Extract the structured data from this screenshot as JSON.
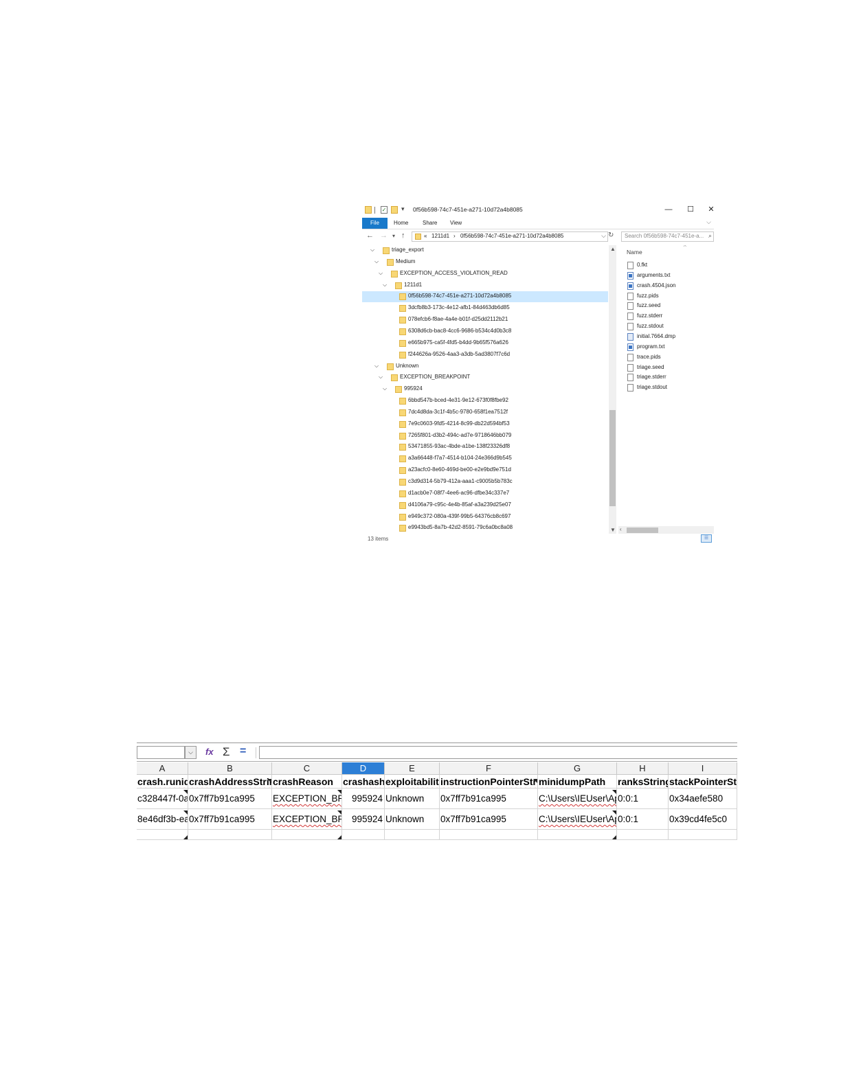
{
  "explorer": {
    "title": "0f56b598-74c7-451e-a271-10d72a4b8085",
    "window_controls": {
      "minimize": "—",
      "maximize": "☐",
      "close": "✕"
    },
    "ribbon_tabs": [
      "File",
      "Home",
      "Share",
      "View"
    ],
    "address": {
      "prefix": "«",
      "crumbs": [
        "1211d1",
        "0f56b598-74c7-451e-a271-10d72a4b8085"
      ],
      "separator": "›"
    },
    "search_placeholder": "Search 0f56b598-74c7-451e-a...",
    "tree": [
      {
        "label": "triage_export",
        "level": 0,
        "expanded": true
      },
      {
        "label": "Medium",
        "level": 1,
        "expanded": true
      },
      {
        "label": "EXCEPTION_ACCESS_VIOLATION_READ",
        "level": 2,
        "expanded": true
      },
      {
        "label": "1211d1",
        "level": 3,
        "expanded": true
      },
      {
        "label": "0f56b598-74c7-451e-a271-10d72a4b8085",
        "level": 4,
        "selected": true
      },
      {
        "label": "3dcfb8b3-173c-4e12-afb1-84d463db6d85",
        "level": 4
      },
      {
        "label": "078efcb6-f8ae-4a4e-b01f-d25dd2112b21",
        "level": 4
      },
      {
        "label": "6308d6cb-bac8-4cc6-9686-b534c4d0b3c8",
        "level": 4
      },
      {
        "label": "e665b975-ca5f-4fd5-b4dd-9b65f576a626",
        "level": 4
      },
      {
        "label": "f244626a-9526-4aa3-a3db-5ad3807f7c6d",
        "level": 4
      },
      {
        "label": "Unknown",
        "level": 1,
        "expanded": true
      },
      {
        "label": "EXCEPTION_BREAKPOINT",
        "level": 2,
        "expanded": true
      },
      {
        "label": "995924",
        "level": 3,
        "expanded": true
      },
      {
        "label": "6bbd547b-bced-4e31-9e12-673f0f8fbe92",
        "level": 4
      },
      {
        "label": "7dc4d8da-3c1f-4b5c-9780-658f1ea7512f",
        "level": 4
      },
      {
        "label": "7e9c0603-9fd5-4214-8c99-db22d594bf53",
        "level": 4
      },
      {
        "label": "7265f801-d3b2-494c-ad7e-9718646bb079",
        "level": 4
      },
      {
        "label": "53471855-93ac-4bde-a1be-138f23326df8",
        "level": 4
      },
      {
        "label": "a3a66448-f7a7-4514-b104-24e366d9b545",
        "level": 4
      },
      {
        "label": "a23acfc0-8e60-469d-be00-e2e9bd9e751d",
        "level": 4
      },
      {
        "label": "c3d9d314-5b79-412a-aaa1-c9005b5b783c",
        "level": 4
      },
      {
        "label": "d1acb0e7-08f7-4ee6-ac96-dfbe34c337e7",
        "level": 4
      },
      {
        "label": "d4106a79-c95c-4e4b-85af-a3a239d25e07",
        "level": 4
      },
      {
        "label": "e949c372-080a-439f-99b5-64376cb8c697",
        "level": 4
      },
      {
        "label": "e9943bd5-8a7b-42d2-8591-79c6a0bc8a08",
        "level": 4
      }
    ],
    "file_header": "Name",
    "files": [
      {
        "name": "0.fkt",
        "type": "file"
      },
      {
        "name": "arguments.txt",
        "type": "doc"
      },
      {
        "name": "crash.4504.json",
        "type": "doc"
      },
      {
        "name": "fuzz.pids",
        "type": "file"
      },
      {
        "name": "fuzz.seed",
        "type": "file"
      },
      {
        "name": "fuzz.stderr",
        "type": "file"
      },
      {
        "name": "fuzz.stdout",
        "type": "file"
      },
      {
        "name": "initial.7664.dmp",
        "type": "dmp"
      },
      {
        "name": "program.txt",
        "type": "doc"
      },
      {
        "name": "trace.pids",
        "type": "file"
      },
      {
        "name": "triage.seed",
        "type": "file"
      },
      {
        "name": "triage.stderr",
        "type": "file"
      },
      {
        "name": "triage.stdout",
        "type": "file"
      }
    ],
    "status": "13 items"
  },
  "sheet": {
    "columns": [
      "A",
      "B",
      "C",
      "D",
      "E",
      "F",
      "G",
      "H",
      "I"
    ],
    "selected_column": "D",
    "header_row": [
      "crash.runid",
      "crashAddressString",
      "crashReason",
      "crashash",
      "exploitability",
      "instructionPointerString",
      "minidumpPath",
      "ranksString",
      "stackPointerString"
    ],
    "rows": [
      [
        "c328447f-0a",
        "0x7ff7b91ca995",
        "EXCEPTION_BR",
        "995924",
        "Unknown",
        "0x7ff7b91ca995",
        "C:\\Users\\IEUser\\Ap",
        "0:0:1",
        "0x34aefe580"
      ],
      [
        "8e46df3b-ea",
        "0x7ff7b91ca995",
        "EXCEPTION_BR",
        "995924",
        "Unknown",
        "0x7ff7b91ca995",
        "C:\\Users\\IEUser\\Ap",
        "0:0:1",
        "0x39cd4fe5c0"
      ]
    ]
  }
}
